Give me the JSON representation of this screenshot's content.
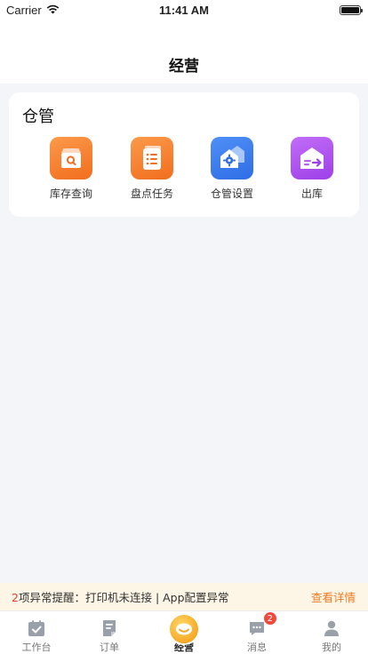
{
  "status_bar": {
    "carrier": "Carrier",
    "time": "11:41 AM"
  },
  "header": {
    "title": "经营"
  },
  "warehouse": {
    "title": "仓管",
    "items": [
      {
        "label": "库存查询",
        "icon": "inventory-search-icon",
        "color": "#f47a2a"
      },
      {
        "label": "盘点任务",
        "icon": "stocktake-list-icon",
        "color": "#f47a2a"
      },
      {
        "label": "仓管设置",
        "icon": "warehouse-settings-icon",
        "color": "#3b7cf0"
      },
      {
        "label": "出库",
        "icon": "outbound-icon",
        "color": "#a94ef0"
      }
    ]
  },
  "alert": {
    "count": "2",
    "count_suffix": "项",
    "message": "异常提醒：打印机未连接 | App配置异常",
    "link": "查看详情"
  },
  "tab_bar": {
    "tabs": [
      {
        "label": "工作台",
        "icon": "calendar-check-icon"
      },
      {
        "label": "订单",
        "icon": "order-doc-icon"
      },
      {
        "label": "经营",
        "icon": "business-icon",
        "active": true
      },
      {
        "label": "消息",
        "icon": "message-icon",
        "badge": "2"
      },
      {
        "label": "我的",
        "icon": "user-icon"
      }
    ]
  },
  "colors": {
    "accent_orange": "#f07a1e",
    "alert_red": "#e5412f",
    "background": "#f4f5f9"
  }
}
